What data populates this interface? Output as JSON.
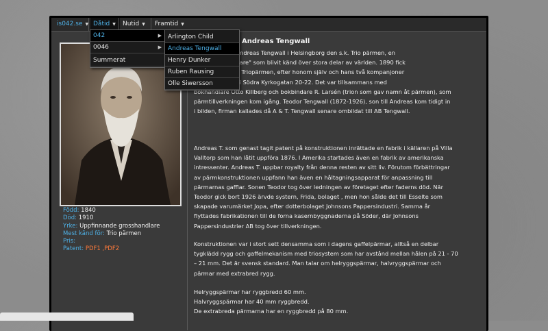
{
  "menu": {
    "home": "is042.se",
    "datid": "Dåtid",
    "nutid": "Nutid",
    "framtid": "Framtid"
  },
  "dropdown_level1": [
    "042",
    "0046",
    "Summerat"
  ],
  "dropdown_level2": [
    "Arlington Child",
    "Andreas Tengwall",
    "Henry Dunker",
    "Ruben Rausing",
    "Olle Siwersson"
  ],
  "article": {
    "title": "Andreas Tengwall",
    "paragraphs": [
      "grosshandlare Andreas Tengwall i Helsingborg den s.k. Trio pärmen, en\n\"pappersanordnare\" som blivit känd över stora delar av världen. 1890 fick\nn under namnet Triopärmen, efter honom själv och hans två kompanjoner\nhandeln höll till i Södra Kyrkogatan 20-22. Det var tillsammans med\nbokhandlare Otto Killberg och bokbindare R. Larsén (trion som gav namn åt pärmen), som\npärmtillverkningen kom igång. Teodor Tengwall (1872-1926), son till Andreas kom tidigt in\ni bilden, firman kallades då A & T. Tengwall senare ombildat till AB Tengwall.",
      "Andreas T. som genast tagit patent på konstruktionen inrättade en fabrik i källaren på Villa\nValltorp som han låtit uppföra 1876. I Amerika startades även en fabrik av amerikanska\nintressenter. Andreas T. uppbar royalty från denna resten av sitt liv. Förutom förbättringar\nav pärmkonstruktionen uppfann han även en håltagningsapparat för anpassning till\npärmarnas gafflar. Sonen Teodor tog över ledningen av företaget efter faderns död. När\nTeodor gick bort 1926 ärvde systern, Frida, bolaget , men hon sålde det till Esselte som\nskapade varumärket Jopa, efter dotterbolaget Johnsons Pappersindustri. Samma år\nflyttades fabrikationen till de forna kasernbyggnaderna på Söder, där Johnsons\nPappersindustrier AB tog över tillverkningen.",
      "Konstruktionen var i stort sett densamma som i dagens gaffelpärmar, alltså en delbar\ntygklädd rygg och gaffelmekanism med triosystem som har avstånd mellan hålen på 21 - 70\n– 21 mm. Det är svensk standard. Man talar om helryggspärmar, halvryggspärmar och\npärmar med extrabred rygg.",
      "Helryggspärmar har ryggbredd 60 mm.\nHalvryggspärmar har 40 mm ryggbredd.\nDe extrabreda pärmarna har en ryggbredd på 80 mm."
    ]
  },
  "facts": [
    {
      "label": "Född:",
      "value": "1840"
    },
    {
      "label": "Död:",
      "value": "1910"
    },
    {
      "label": "Yrke:",
      "value": "Uppfinnande grosshandlare"
    },
    {
      "label": "Mest känd för:",
      "value": "Trio pärmen"
    },
    {
      "label": "Pris:",
      "value": ""
    },
    {
      "label": "Patent:",
      "value": "PDF1 ,PDF2"
    }
  ],
  "colors": {
    "accent_blue": "#4fb2e8",
    "link_orange": "#ff7a3a",
    "panel_bg": "#3a3a3a"
  }
}
